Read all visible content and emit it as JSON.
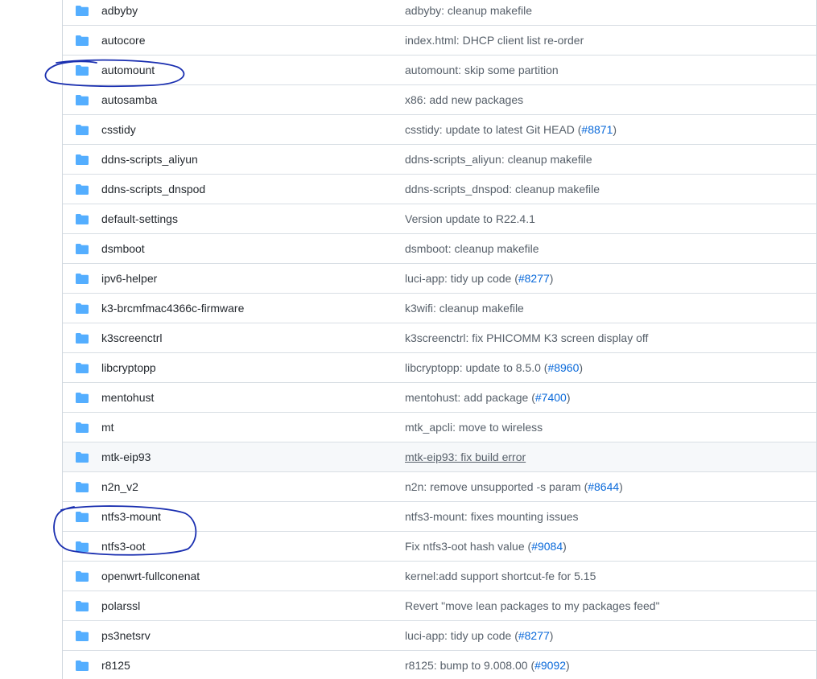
{
  "colors": {
    "folder_icon": "#54aeff",
    "link_blue": "#0969da",
    "annotation_ink": "#1a2fb0"
  },
  "rows": [
    {
      "name": "adbyby",
      "message": "adbyby: cleanup makefile",
      "pr": ""
    },
    {
      "name": "autocore",
      "message": "index.html: DHCP client list re-order",
      "pr": ""
    },
    {
      "name": "automount",
      "message": "automount: skip some partition",
      "pr": ""
    },
    {
      "name": "autosamba",
      "message": "x86: add new packages",
      "pr": ""
    },
    {
      "name": "csstidy",
      "message": "csstidy: update to latest Git HEAD (",
      "pr": "#8871",
      "tail": ")"
    },
    {
      "name": "ddns-scripts_aliyun",
      "message": "ddns-scripts_aliyun: cleanup makefile",
      "pr": ""
    },
    {
      "name": "ddns-scripts_dnspod",
      "message": "ddns-scripts_dnspod: cleanup makefile",
      "pr": ""
    },
    {
      "name": "default-settings",
      "message": "Version update to R22.4.1",
      "pr": ""
    },
    {
      "name": "dsmboot",
      "message": "dsmboot: cleanup makefile",
      "pr": ""
    },
    {
      "name": "ipv6-helper",
      "message": "luci-app: tidy up code (",
      "pr": "#8277",
      "tail": ")"
    },
    {
      "name": "k3-brcmfmac4366c-firmware",
      "message": "k3wifi: cleanup makefile",
      "pr": ""
    },
    {
      "name": "k3screenctrl",
      "message": "k3screenctrl: fix PHICOMM K3 screen display off",
      "pr": ""
    },
    {
      "name": "libcryptopp",
      "message": "libcryptopp: update to 8.5.0 (",
      "pr": "#8960",
      "tail": ")"
    },
    {
      "name": "mentohust",
      "message": "mentohust: add package (",
      "pr": "#7400",
      "tail": ")"
    },
    {
      "name": "mt",
      "message": "mtk_apcli: move to wireless",
      "pr": ""
    },
    {
      "name": "mtk-eip93",
      "message": "mtk-eip93: fix build error",
      "pr": "",
      "hover": true
    },
    {
      "name": "n2n_v2",
      "message": "n2n: remove unsupported -s param (",
      "pr": "#8644",
      "tail": ")"
    },
    {
      "name": "ntfs3-mount",
      "message": "ntfs3-mount: fixes mounting issues",
      "pr": ""
    },
    {
      "name": "ntfs3-oot",
      "message": "Fix ntfs3-oot hash value (",
      "pr": "#9084",
      "tail": ")"
    },
    {
      "name": "openwrt-fullconenat",
      "message": "kernel:add support shortcut-fe for 5.15",
      "pr": ""
    },
    {
      "name": "polarssl",
      "message": "Revert \"move lean packages to my packages feed\"",
      "pr": ""
    },
    {
      "name": "ps3netsrv",
      "message": "luci-app: tidy up code (",
      "pr": "#8277",
      "tail": ")"
    },
    {
      "name": "r8125",
      "message": "r8125: bump to 9.008.00 (",
      "pr": "#9092",
      "tail": ")"
    }
  ]
}
